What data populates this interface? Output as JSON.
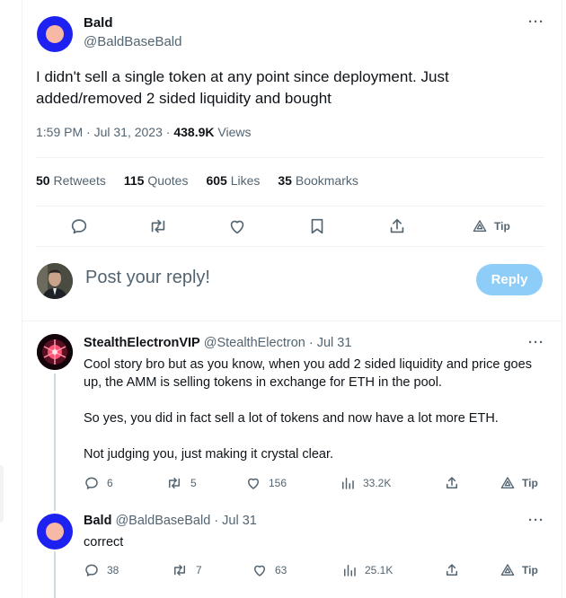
{
  "main_tweet": {
    "author_name": "Bald",
    "author_handle": "@BaldBaseBald",
    "text": "I didn't sell a single token at any point since deployment. Just added/removed 2 sided liquidity and bought",
    "time": "1:59 PM",
    "date": "Jul 31, 2023",
    "views_count": "438.9K",
    "views_label": "Views",
    "stats": [
      {
        "count": "50",
        "label": "Retweets"
      },
      {
        "count": "115",
        "label": "Quotes"
      },
      {
        "count": "605",
        "label": "Likes"
      },
      {
        "count": "35",
        "label": "Bookmarks"
      }
    ],
    "tip_label": "Tip"
  },
  "reply_box": {
    "placeholder": "Post your reply!",
    "button_label": "Reply"
  },
  "replies": [
    {
      "author_name": "StealthElectronVIP",
      "author_handle": "@StealthElectron",
      "date": "Jul 31",
      "paragraphs": [
        "Cool story bro but as you know, when you add 2 sided liquidity and price goes up, the AMM is selling tokens in exchange for ETH in the pool.",
        "So yes, you did in fact sell a lot of tokens and now have a lot more ETH.",
        "Not judging you, just making it crystal clear."
      ],
      "replies": "6",
      "retweets": "5",
      "likes": "156",
      "views": "33.2K",
      "tip_label": "Tip"
    },
    {
      "author_name": "Bald",
      "author_handle": "@BaldBaseBald",
      "date": "Jul 31",
      "paragraphs": [
        "correct"
      ],
      "replies": "38",
      "retweets": "7",
      "likes": "63",
      "views": "25.1K",
      "tip_label": "Tip"
    }
  ],
  "colors": {
    "accent": "#1d9bf0",
    "reply_button": "#8ecdf7",
    "muted": "#536471",
    "bald_avatar_ring": "#1d22f0",
    "bald_avatar_center": "#f7b8a5"
  }
}
